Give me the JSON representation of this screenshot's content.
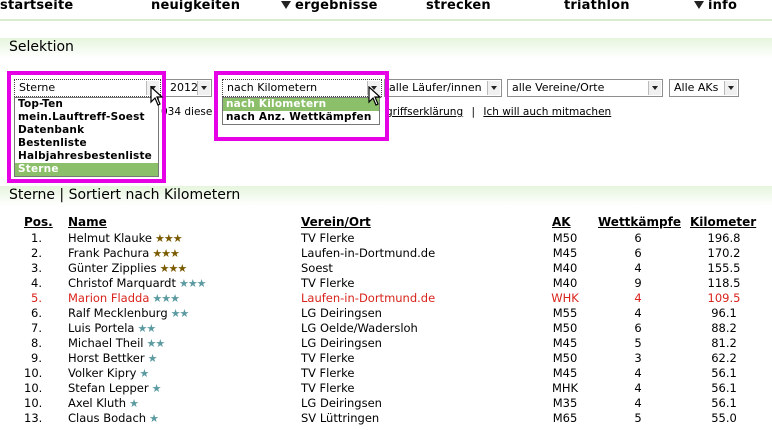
{
  "nav": {
    "items": [
      {
        "label": "startseite",
        "arrow": false
      },
      {
        "label": "neuigkeiten",
        "arrow": false
      },
      {
        "label": "ergebnisse",
        "arrow": true
      },
      {
        "label": "strecken",
        "arrow": false
      },
      {
        "label": "triathlon",
        "arrow": false
      },
      {
        "label": "info",
        "arrow": true
      }
    ]
  },
  "selection": {
    "title": "Selektion",
    "list_select": {
      "value": "Sterne"
    },
    "list_options": [
      "Top-Ten",
      "mein.Lauftreff-Soest",
      "Datenbank",
      "Bestenliste",
      "Halbjahresbestenliste",
      "Sterne"
    ],
    "year_select": {
      "value": "2012"
    },
    "sort_select": {
      "value": "nach Kilometern"
    },
    "sort_options": [
      "nach Kilometern",
      "nach Anz. Wettkämpfen"
    ],
    "runner_select": {
      "value": "alle Läufer/innen"
    },
    "club_select": {
      "value": "alle Vereine/Orte"
    },
    "ak_select": {
      "value": "Alle AKs"
    },
    "info_fragment_1": "034 diese",
    "info_fragment_2": "griffserklärung",
    "info_separator": "|",
    "info_link": "Ich will auch mitmachen"
  },
  "results": {
    "title": "Sterne | Sortiert nach Kilometern",
    "headers": {
      "pos": "Pos.",
      "name": "Name",
      "club": "Verein/Ort",
      "ak": "AK",
      "wk": "Wettkämpfe",
      "km": "Kilometer"
    },
    "rows": [
      {
        "pos": "1.",
        "name": "Helmut Klauke",
        "stars": "★★★",
        "star_color": "gold",
        "club": "TV Flerke",
        "ak": "M50",
        "wk": "6",
        "km": "196.8",
        "highlight": false
      },
      {
        "pos": "2.",
        "name": "Frank Pachura",
        "stars": "★★★",
        "star_color": "gold",
        "club": "Laufen-in-Dortmund.de",
        "ak": "M45",
        "wk": "6",
        "km": "170.2",
        "highlight": false
      },
      {
        "pos": "3.",
        "name": "Günter Zipplies",
        "stars": "★★★",
        "star_color": "gold",
        "club": "Soest",
        "ak": "M40",
        "wk": "4",
        "km": "155.5",
        "highlight": false
      },
      {
        "pos": "4.",
        "name": "Christof Marquardt",
        "stars": "★★★",
        "star_color": "teal",
        "club": "TV Flerke",
        "ak": "M40",
        "wk": "9",
        "km": "118.5",
        "highlight": false
      },
      {
        "pos": "5.",
        "name": "Marion Fladda",
        "stars": "★★★",
        "star_color": "teal",
        "club": "Laufen-in-Dortmund.de",
        "ak": "WHK",
        "wk": "4",
        "km": "109.5",
        "highlight": true
      },
      {
        "pos": "6.",
        "name": "Ralf Mecklenburg",
        "stars": "★★",
        "star_color": "teal",
        "club": "LG Deiringsen",
        "ak": "M55",
        "wk": "4",
        "km": "96.1",
        "highlight": false
      },
      {
        "pos": "7.",
        "name": "Luis Portela",
        "stars": "★★",
        "star_color": "teal",
        "club": "LG Oelde/Wadersloh",
        "ak": "M50",
        "wk": "6",
        "km": "88.2",
        "highlight": false
      },
      {
        "pos": "8.",
        "name": "Michael Theil",
        "stars": "★★",
        "star_color": "teal",
        "club": "LG Deiringsen",
        "ak": "M45",
        "wk": "5",
        "km": "81.2",
        "highlight": false
      },
      {
        "pos": "9.",
        "name": "Horst Bettker",
        "stars": "★",
        "star_color": "teal",
        "club": "TV Flerke",
        "ak": "M50",
        "wk": "3",
        "km": "62.2",
        "highlight": false
      },
      {
        "pos": "10.",
        "name": "Volker Kipry",
        "stars": "★",
        "star_color": "teal",
        "club": "TV Flerke",
        "ak": "M45",
        "wk": "4",
        "km": "56.1",
        "highlight": false
      },
      {
        "pos": "10.",
        "name": "Stefan Lepper",
        "stars": "★",
        "star_color": "teal",
        "club": "TV Flerke",
        "ak": "MHK",
        "wk": "4",
        "km": "56.1",
        "highlight": false
      },
      {
        "pos": "10.",
        "name": "Axel Kluth",
        "stars": "★",
        "star_color": "teal",
        "club": "LG Deiringsen",
        "ak": "M35",
        "wk": "4",
        "km": "56.1",
        "highlight": false
      },
      {
        "pos": "13.",
        "name": "Claus Bodach",
        "stars": "★",
        "star_color": "teal",
        "club": "SV Lüttringen",
        "ak": "M65",
        "wk": "5",
        "km": "55.0",
        "highlight": false
      }
    ]
  },
  "colors": {
    "accent_green": "#8bbf6a",
    "highlight_box": "#e600e6",
    "name_red": "#d8241c"
  }
}
